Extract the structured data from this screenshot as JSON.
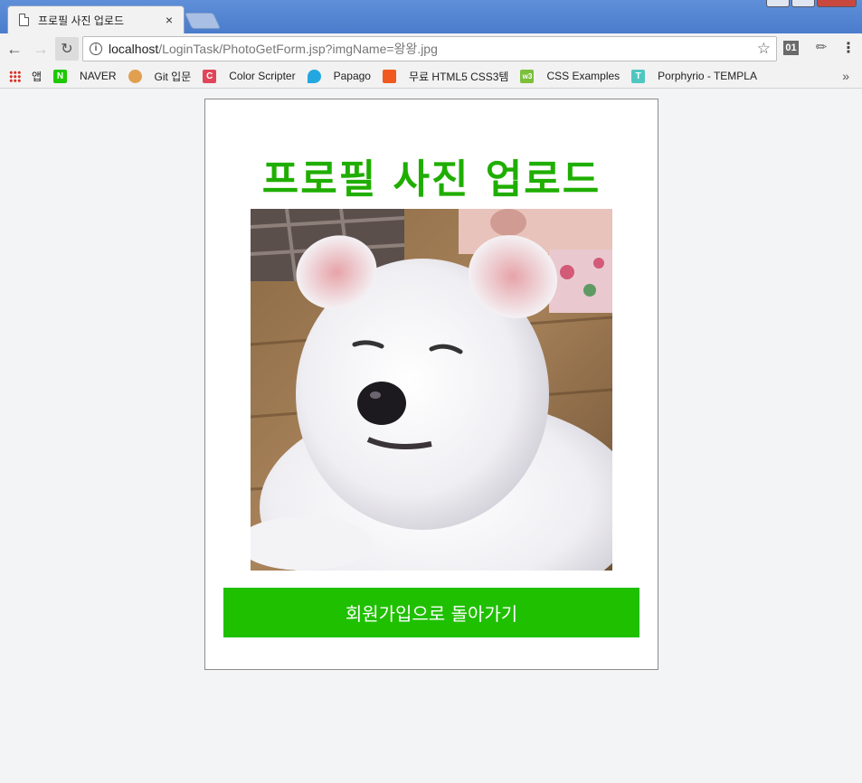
{
  "browser": {
    "tab_title": "프로필 사진 업로드",
    "tab_close": "×",
    "url_host": "localhost",
    "url_rest": "/LoginTask/PhotoGetForm.jsp?imgName=왕왕.jpg",
    "ext_label": "01"
  },
  "bookmarks": [
    {
      "label": "앱",
      "icon": "apps-grid-icon"
    },
    {
      "label": "NAVER",
      "icon": "naver-icon",
      "icon_text": "N",
      "color": "#1ec800"
    },
    {
      "label": "Git 입문",
      "icon": "git-icon",
      "icon_text": "",
      "color": "#e0a050"
    },
    {
      "label": "Color Scripter",
      "icon": "color-scripter-icon",
      "icon_text": "C",
      "color": "#e0455a"
    },
    {
      "label": "Papago",
      "icon": "papago-icon",
      "icon_text": "",
      "color": "#22a7e0"
    },
    {
      "label": "무료 HTML5 CSS3템",
      "icon": "html5-template-icon",
      "icon_text": "",
      "color": "#f05a1e"
    },
    {
      "label": "CSS Examples",
      "icon": "css-examples-icon",
      "icon_text": "w3",
      "color": "#7bbf3b"
    },
    {
      "label": "Porphyrio - TEMPLA",
      "icon": "porphyrio-icon",
      "icon_text": "T",
      "color": "#4fc7c0"
    }
  ],
  "bookmarks_more": "»",
  "page": {
    "title": "프로필 사진 업로드",
    "back_button_label": "회원가입으로 돌아가기",
    "photo_alt": "왕왕.jpg"
  },
  "colors": {
    "title_green": "#1fae00",
    "button_green": "#1fc000",
    "page_bg": "#f3f4f6"
  }
}
